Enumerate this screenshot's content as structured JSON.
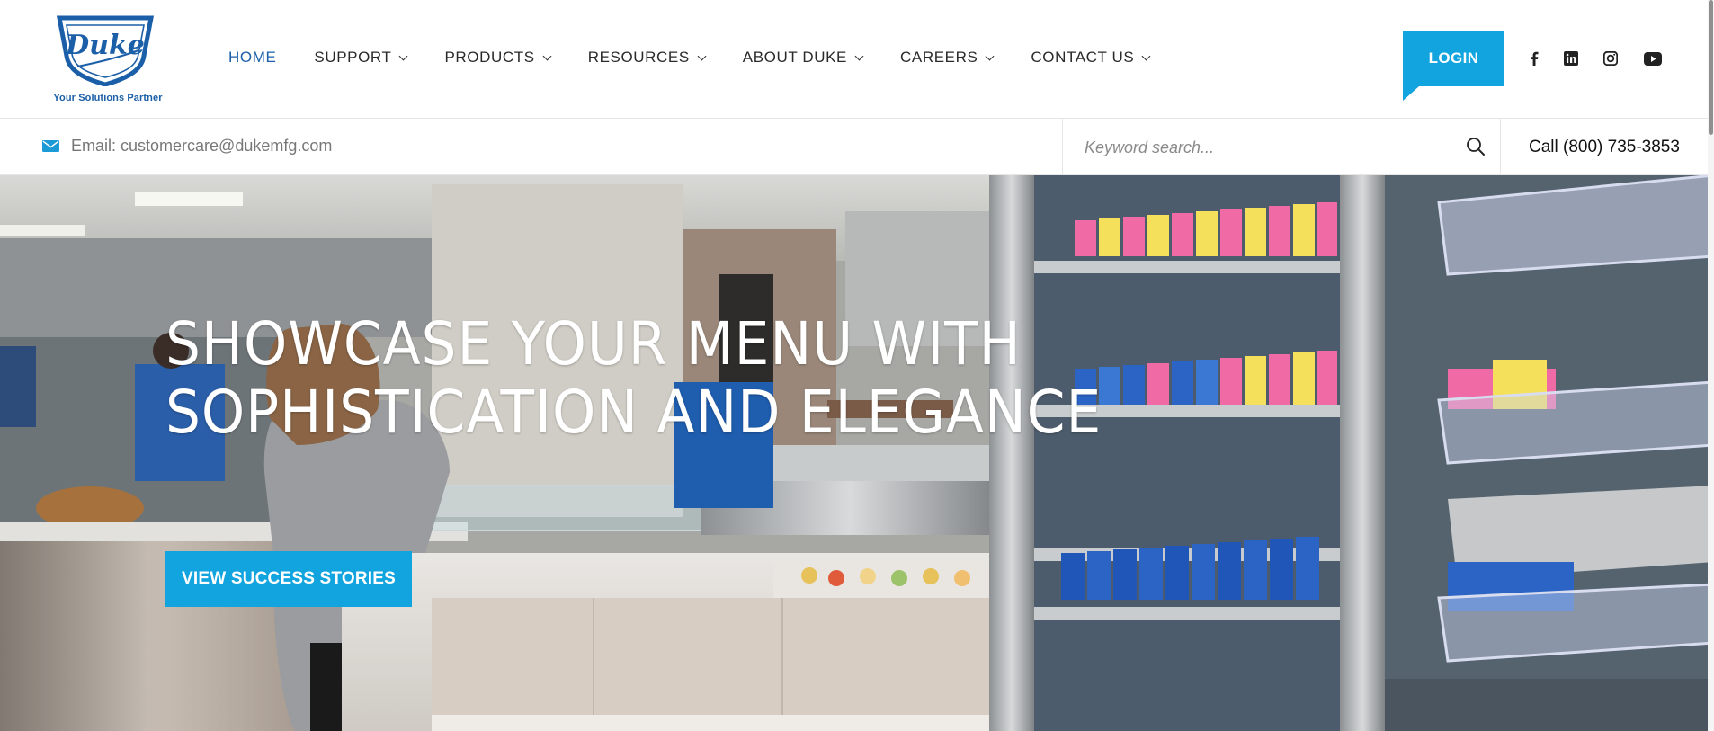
{
  "brand": {
    "logo_text": "Duke",
    "tagline": "Your Solutions Partner",
    "primary_color": "#1b5fa8",
    "accent_color": "#12a4df"
  },
  "nav": {
    "items": [
      {
        "label": "HOME",
        "active": true,
        "has_dropdown": false
      },
      {
        "label": "SUPPORT",
        "active": false,
        "has_dropdown": true
      },
      {
        "label": "PRODUCTS",
        "active": false,
        "has_dropdown": true
      },
      {
        "label": "RESOURCES",
        "active": false,
        "has_dropdown": true
      },
      {
        "label": "ABOUT DUKE",
        "active": false,
        "has_dropdown": true
      },
      {
        "label": "CAREERS",
        "active": false,
        "has_dropdown": true
      },
      {
        "label": "CONTACT US",
        "active": false,
        "has_dropdown": true
      }
    ],
    "login_label": "LOGIN"
  },
  "social": [
    {
      "name": "facebook-icon"
    },
    {
      "name": "linkedin-icon"
    },
    {
      "name": "instagram-icon"
    },
    {
      "name": "youtube-icon"
    }
  ],
  "infobar": {
    "email_label": "Email: customercare@dukemfg.com",
    "search_placeholder": "Keyword search...",
    "search_value": "",
    "phone_label": "Call (800) 735-3853"
  },
  "hero": {
    "title_line1": "SHOWCASE YOUR MENU WITH",
    "title_line2": "SOPHISTICATION AND ELEGANCE",
    "button_label": "VIEW SUCCESS STORIES"
  }
}
